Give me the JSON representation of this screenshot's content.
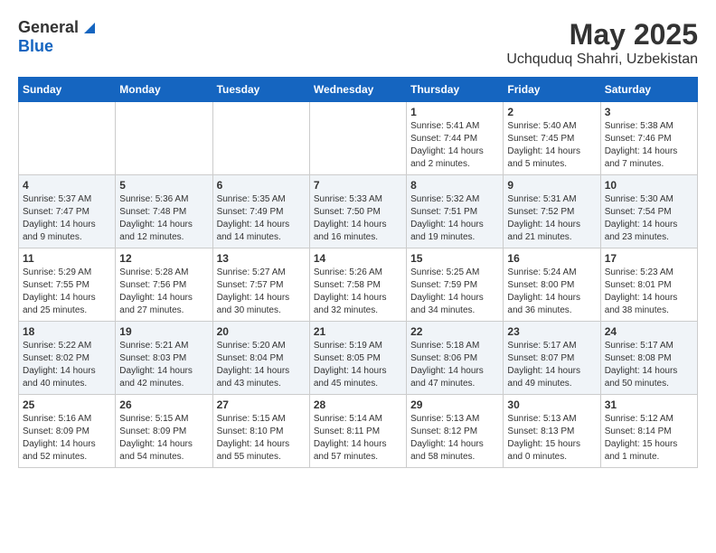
{
  "header": {
    "logo_general": "General",
    "logo_blue": "Blue",
    "month_title": "May 2025",
    "location": "Uchquduq Shahri, Uzbekistan"
  },
  "weekdays": [
    "Sunday",
    "Monday",
    "Tuesday",
    "Wednesday",
    "Thursday",
    "Friday",
    "Saturday"
  ],
  "weeks": [
    [
      {
        "day": "",
        "info": ""
      },
      {
        "day": "",
        "info": ""
      },
      {
        "day": "",
        "info": ""
      },
      {
        "day": "",
        "info": ""
      },
      {
        "day": "1",
        "info": "Sunrise: 5:41 AM\nSunset: 7:44 PM\nDaylight: 14 hours\nand 2 minutes."
      },
      {
        "day": "2",
        "info": "Sunrise: 5:40 AM\nSunset: 7:45 PM\nDaylight: 14 hours\nand 5 minutes."
      },
      {
        "day": "3",
        "info": "Sunrise: 5:38 AM\nSunset: 7:46 PM\nDaylight: 14 hours\nand 7 minutes."
      }
    ],
    [
      {
        "day": "4",
        "info": "Sunrise: 5:37 AM\nSunset: 7:47 PM\nDaylight: 14 hours\nand 9 minutes."
      },
      {
        "day": "5",
        "info": "Sunrise: 5:36 AM\nSunset: 7:48 PM\nDaylight: 14 hours\nand 12 minutes."
      },
      {
        "day": "6",
        "info": "Sunrise: 5:35 AM\nSunset: 7:49 PM\nDaylight: 14 hours\nand 14 minutes."
      },
      {
        "day": "7",
        "info": "Sunrise: 5:33 AM\nSunset: 7:50 PM\nDaylight: 14 hours\nand 16 minutes."
      },
      {
        "day": "8",
        "info": "Sunrise: 5:32 AM\nSunset: 7:51 PM\nDaylight: 14 hours\nand 19 minutes."
      },
      {
        "day": "9",
        "info": "Sunrise: 5:31 AM\nSunset: 7:52 PM\nDaylight: 14 hours\nand 21 minutes."
      },
      {
        "day": "10",
        "info": "Sunrise: 5:30 AM\nSunset: 7:54 PM\nDaylight: 14 hours\nand 23 minutes."
      }
    ],
    [
      {
        "day": "11",
        "info": "Sunrise: 5:29 AM\nSunset: 7:55 PM\nDaylight: 14 hours\nand 25 minutes."
      },
      {
        "day": "12",
        "info": "Sunrise: 5:28 AM\nSunset: 7:56 PM\nDaylight: 14 hours\nand 27 minutes."
      },
      {
        "day": "13",
        "info": "Sunrise: 5:27 AM\nSunset: 7:57 PM\nDaylight: 14 hours\nand 30 minutes."
      },
      {
        "day": "14",
        "info": "Sunrise: 5:26 AM\nSunset: 7:58 PM\nDaylight: 14 hours\nand 32 minutes."
      },
      {
        "day": "15",
        "info": "Sunrise: 5:25 AM\nSunset: 7:59 PM\nDaylight: 14 hours\nand 34 minutes."
      },
      {
        "day": "16",
        "info": "Sunrise: 5:24 AM\nSunset: 8:00 PM\nDaylight: 14 hours\nand 36 minutes."
      },
      {
        "day": "17",
        "info": "Sunrise: 5:23 AM\nSunset: 8:01 PM\nDaylight: 14 hours\nand 38 minutes."
      }
    ],
    [
      {
        "day": "18",
        "info": "Sunrise: 5:22 AM\nSunset: 8:02 PM\nDaylight: 14 hours\nand 40 minutes."
      },
      {
        "day": "19",
        "info": "Sunrise: 5:21 AM\nSunset: 8:03 PM\nDaylight: 14 hours\nand 42 minutes."
      },
      {
        "day": "20",
        "info": "Sunrise: 5:20 AM\nSunset: 8:04 PM\nDaylight: 14 hours\nand 43 minutes."
      },
      {
        "day": "21",
        "info": "Sunrise: 5:19 AM\nSunset: 8:05 PM\nDaylight: 14 hours\nand 45 minutes."
      },
      {
        "day": "22",
        "info": "Sunrise: 5:18 AM\nSunset: 8:06 PM\nDaylight: 14 hours\nand 47 minutes."
      },
      {
        "day": "23",
        "info": "Sunrise: 5:17 AM\nSunset: 8:07 PM\nDaylight: 14 hours\nand 49 minutes."
      },
      {
        "day": "24",
        "info": "Sunrise: 5:17 AM\nSunset: 8:08 PM\nDaylight: 14 hours\nand 50 minutes."
      }
    ],
    [
      {
        "day": "25",
        "info": "Sunrise: 5:16 AM\nSunset: 8:09 PM\nDaylight: 14 hours\nand 52 minutes."
      },
      {
        "day": "26",
        "info": "Sunrise: 5:15 AM\nSunset: 8:09 PM\nDaylight: 14 hours\nand 54 minutes."
      },
      {
        "day": "27",
        "info": "Sunrise: 5:15 AM\nSunset: 8:10 PM\nDaylight: 14 hours\nand 55 minutes."
      },
      {
        "day": "28",
        "info": "Sunrise: 5:14 AM\nSunset: 8:11 PM\nDaylight: 14 hours\nand 57 minutes."
      },
      {
        "day": "29",
        "info": "Sunrise: 5:13 AM\nSunset: 8:12 PM\nDaylight: 14 hours\nand 58 minutes."
      },
      {
        "day": "30",
        "info": "Sunrise: 5:13 AM\nSunset: 8:13 PM\nDaylight: 15 hours\nand 0 minutes."
      },
      {
        "day": "31",
        "info": "Sunrise: 5:12 AM\nSunset: 8:14 PM\nDaylight: 15 hours\nand 1 minute."
      }
    ]
  ]
}
